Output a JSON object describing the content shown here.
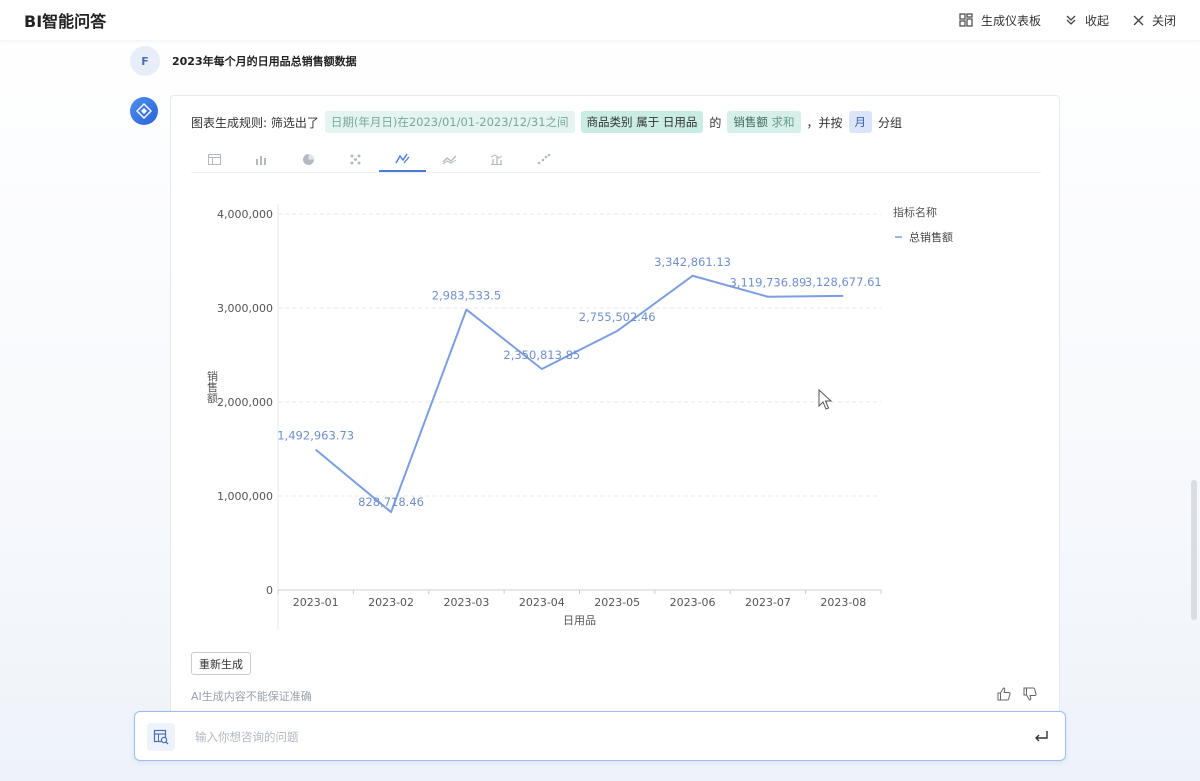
{
  "header": {
    "title": "BI智能问答",
    "actions": {
      "dashboard": "生成仪表板",
      "collapse": "收起",
      "close": "关闭"
    }
  },
  "conversation": {
    "user": {
      "avatar_letter": "F",
      "message": "2023年每个月的日用品总销售额数据"
    },
    "answer": {
      "rule_prefix": "图表生成规则: 筛选出了",
      "chip_date": "日期(年月日)在2023/01/01-2023/12/31之间",
      "chip_category": "商品类别 属于 日用品",
      "word_of": "的",
      "chip_measure_name": "销售额",
      "chip_measure_agg": "求和",
      "word_group_by": "，并按",
      "chip_month": "月",
      "word_group": "分组",
      "chart_type_tabs": [
        "table-icon",
        "bar-chart-icon",
        "pie-chart-icon",
        "scatter-grid-icon",
        "line-chart-icon",
        "area-chart-icon",
        "combo-chart-icon",
        "dot-chart-icon"
      ],
      "active_tab_index": 4,
      "regenerate_label": "重新生成",
      "disclaimer": "AI生成内容不能保证准确"
    }
  },
  "chart_data": {
    "type": "line",
    "categories": [
      "2023-01",
      "2023-02",
      "2023-03",
      "2023-04",
      "2023-05",
      "2023-06",
      "2023-07",
      "2023-08"
    ],
    "series": [
      {
        "name": "总销售额",
        "values": [
          1492963.73,
          828718.46,
          2983533.5,
          2350813.85,
          2755502.46,
          3342861.13,
          3119736.89,
          3128677.61
        ],
        "labels": [
          "1,492,963.73",
          "828,718.46",
          "2,983,533.5",
          "2,350,813.85",
          "2,755,502.46",
          "3,342,861.13",
          "3,119,736.89",
          "3,128,677.61"
        ],
        "color": "#7b9ee0"
      }
    ],
    "xlabel": "日用品",
    "ylabel": "销售额",
    "ylim": [
      0,
      4000000
    ],
    "yticks": [
      0,
      1000000,
      2000000,
      3000000,
      4000000
    ],
    "ytick_labels": [
      "0",
      "1,000,000",
      "2,000,000",
      "3,000,000",
      "4,000,000"
    ],
    "legend_title": "指标名称",
    "legend_position": "top-right",
    "grid": true
  },
  "input": {
    "placeholder": "输入你想咨询的问题",
    "value": ""
  },
  "colors": {
    "accent": "#4a7bd6",
    "line": "#7b9ee0",
    "chip_teal": "#c9ece3"
  }
}
